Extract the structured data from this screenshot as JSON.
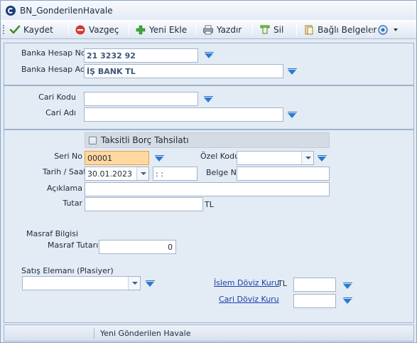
{
  "window": {
    "title": "BN_GonderilenHavale"
  },
  "toolbar": {
    "kaydet": "Kaydet",
    "vazgec": "Vazgeç",
    "yeni_ekle": "Yeni Ekle",
    "yazdir": "Yazdır",
    "sil": "Sil",
    "bagli_belgeler": "Bağlı Belgeler"
  },
  "bank": {
    "hesap_no_label": "Banka Hesap No",
    "hesap_no_value": "21 3232 92",
    "hesap_adi_label": "Banka Hesap Adı",
    "hesap_adi_value": "İŞ BANK TL"
  },
  "cari": {
    "kod_label": "Cari Kodu",
    "kod_value": "",
    "ad_label": "Cari Adı",
    "ad_value": ""
  },
  "main": {
    "taksit_label": "Taksitli Borç Tahsilatı",
    "taksit_checked": false,
    "seri_no_label": "Seri No",
    "seri_no_value": "00001",
    "ozel_kodu_label": "Özel Kodu",
    "ozel_kodu_value": "",
    "tarih_saat_label": "Tarih / Saat",
    "tarih_value": "30.01.2023",
    "saat_value": " :  :",
    "belge_no_label": "Belge No",
    "belge_no_value": "",
    "aciklama_label": "Açıklama",
    "aciklama_value": "",
    "tutar_label": "Tutar",
    "tutar_value": "",
    "tutar_currency": "TL",
    "masraf_bilgisi_label": "Masraf Bilgisi",
    "masraf_tutari_label": "Masraf Tutarı",
    "masraf_tutari_value": "0",
    "satis_elemani_label": "Satış Elemanı (Plasiyer)",
    "satis_elemani_value": "",
    "islem_doviz_label": "İslem Döviz Kuru",
    "islem_doviz_currency": "TL",
    "islem_doviz_value": "",
    "cari_doviz_label": "Cari Döviz Kuru",
    "cari_doviz_value": ""
  },
  "status": {
    "text": "Yeni Gönderilen Havale"
  }
}
